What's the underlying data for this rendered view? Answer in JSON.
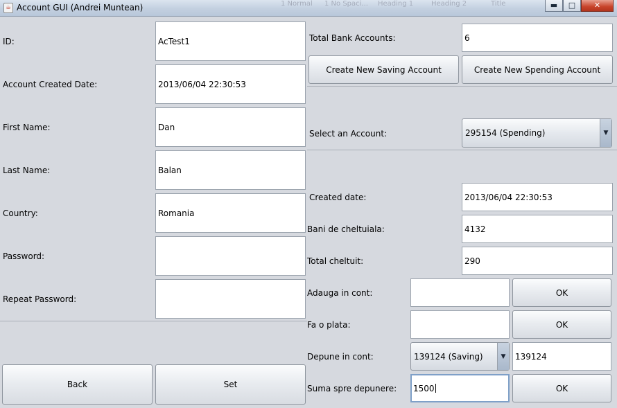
{
  "window": {
    "title": "Account GUI (Andrei Muntean)",
    "app_icon": "java-cup-icon",
    "background_ghost": [
      "1 Normal",
      "1 No Spaci...",
      "Heading 1",
      "Heading 2",
      "Title"
    ],
    "controls": {
      "minimize": "▬",
      "maximize": "□",
      "close": "✕"
    }
  },
  "account": {
    "id_label": "ID:",
    "id_value": "AcTest1",
    "created_label": "Account Created Date:",
    "created_value": "2013/06/04 22:30:53",
    "first_name_label": "First Name:",
    "first_name_value": "Dan",
    "last_name_label": "Last Name:",
    "last_name_value": "Balan",
    "country_label": "Country:",
    "country_value": "Romania",
    "password_label": "Password:",
    "password_value": "",
    "repeat_password_label": "Repeat Password:",
    "repeat_password_value": ""
  },
  "bottom_buttons": {
    "back": "Back",
    "set": "Set"
  },
  "bank": {
    "total_label": "Total Bank Accounts:",
    "total_value": "6",
    "new_saving": "Create New Saving Account",
    "new_spending": "Create New Spending Account",
    "select_label": "Select an Account:",
    "select_value": "295154 (Spending)"
  },
  "details": {
    "created_label": "Created date:",
    "created_value": "2013/06/04 22:30:53",
    "spend_money_label": "Bani de cheltuiala:",
    "spend_money_value": "4132",
    "total_spent_label": "Total cheltuit:",
    "total_spent_value": "290",
    "add_label": "Adauga in cont:",
    "add_value": "",
    "add_ok": "OK",
    "pay_label": "Fa o plata:",
    "pay_value": "",
    "pay_ok": "OK",
    "deposit_label": "Depune in cont:",
    "deposit_select": "139124 (Saving)",
    "deposit_target": "139124",
    "amount_label": "Suma spre depunere:",
    "amount_value": "1500",
    "amount_ok": "OK"
  }
}
